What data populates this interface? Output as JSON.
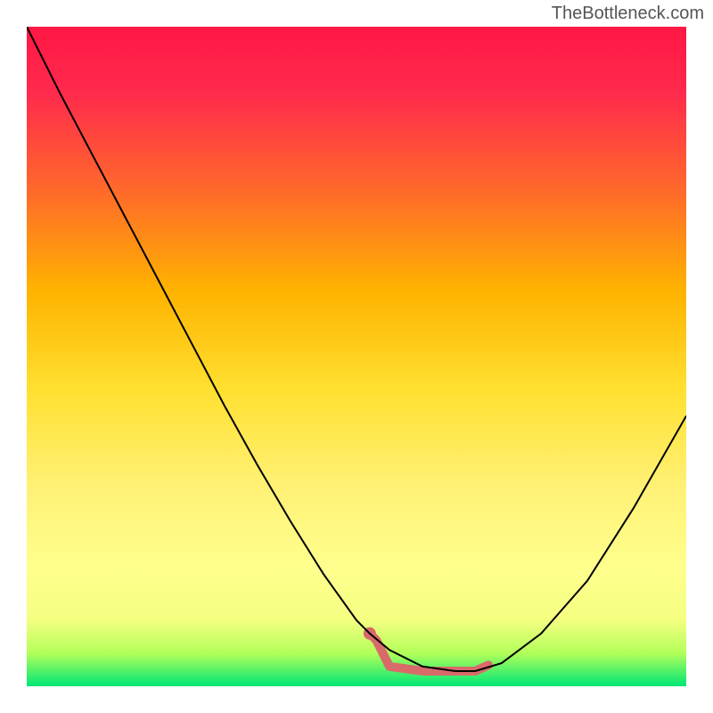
{
  "watermark": "TheBottleneck.com",
  "chart_data": {
    "type": "line",
    "title": "",
    "xlabel": "",
    "ylabel": "",
    "xlim": [
      0,
      100
    ],
    "ylim": [
      0,
      100
    ],
    "gradient_stops": [
      {
        "offset": 0,
        "color": "#ff1744"
      },
      {
        "offset": 10,
        "color": "#ff2a4d"
      },
      {
        "offset": 25,
        "color": "#ff6a2a"
      },
      {
        "offset": 40,
        "color": "#ffb300"
      },
      {
        "offset": 55,
        "color": "#ffe030"
      },
      {
        "offset": 70,
        "color": "#fff176"
      },
      {
        "offset": 82,
        "color": "#ffff8d"
      },
      {
        "offset": 90,
        "color": "#f4ff81"
      },
      {
        "offset": 95,
        "color": "#b2ff59"
      },
      {
        "offset": 100,
        "color": "#00e676"
      }
    ],
    "series": [
      {
        "name": "curve",
        "color": "#000000",
        "width": 2,
        "x": [
          0,
          5,
          10,
          15,
          20,
          25,
          30,
          35,
          40,
          45,
          50,
          52,
          55,
          60,
          65,
          68,
          72,
          78,
          85,
          92,
          100
        ],
        "y": [
          100,
          90,
          80.5,
          71,
          61.5,
          52,
          42.5,
          33.5,
          25,
          17,
          10,
          8,
          5.5,
          3,
          2.3,
          2.3,
          3.5,
          8,
          16,
          27,
          41
        ]
      },
      {
        "name": "highlight",
        "color": "#d96a6a",
        "width": 10,
        "cap": "round",
        "x": [
          52,
          53,
          55,
          60,
          65,
          68,
          70
        ],
        "y": [
          8,
          7,
          3,
          2.3,
          2.3,
          2.3,
          3.2
        ]
      }
    ],
    "highlight_dot": {
      "x": 52,
      "y": 8,
      "r": 7,
      "color": "#d96a6a"
    }
  }
}
